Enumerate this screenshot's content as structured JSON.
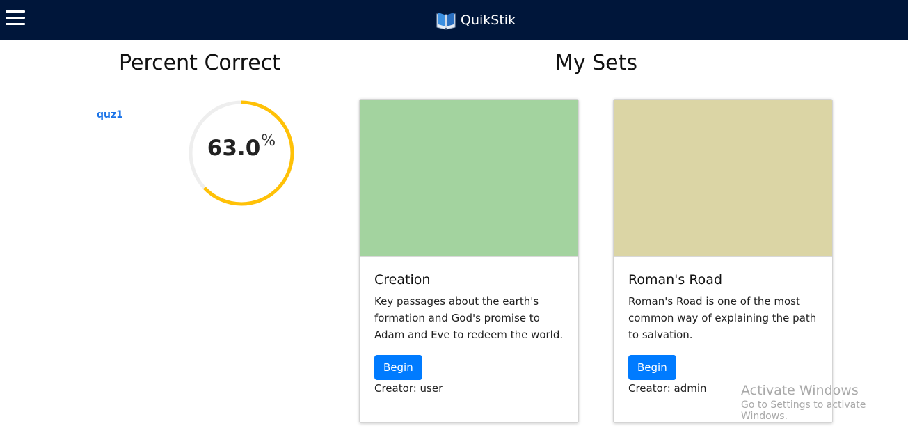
{
  "navbar": {
    "brand_name": "QuikStik",
    "menu_icon": "hamburger-icon",
    "logo_icon": "open-book-icon",
    "background_color": "#00163a"
  },
  "stats": {
    "title": "Percent Correct",
    "quiz_name": "quz1",
    "percent_text": "63.0",
    "percent_unit": "%",
    "percent_value": 63.0,
    "ring_color": "#ffc107",
    "track_color": "#eeeeee"
  },
  "sets": {
    "title": "My Sets",
    "cards": [
      {
        "title": "Creation",
        "description": "Key passages about the earth's formation and God's promise to Adam and Eve to redeem the world.",
        "button_label": "Begin",
        "creator": "Creator: user",
        "image_color": "#a3d39f"
      },
      {
        "title": "Roman's Road",
        "description": "Roman's Road is one of the most common way of explaining the path to salvation.",
        "button_label": "Begin",
        "creator": "Creator: admin",
        "image_color": "#dbd5a5"
      }
    ]
  },
  "watermark": {
    "title": "Activate Windows",
    "subtitle": "Go to Settings to activate Windows."
  }
}
